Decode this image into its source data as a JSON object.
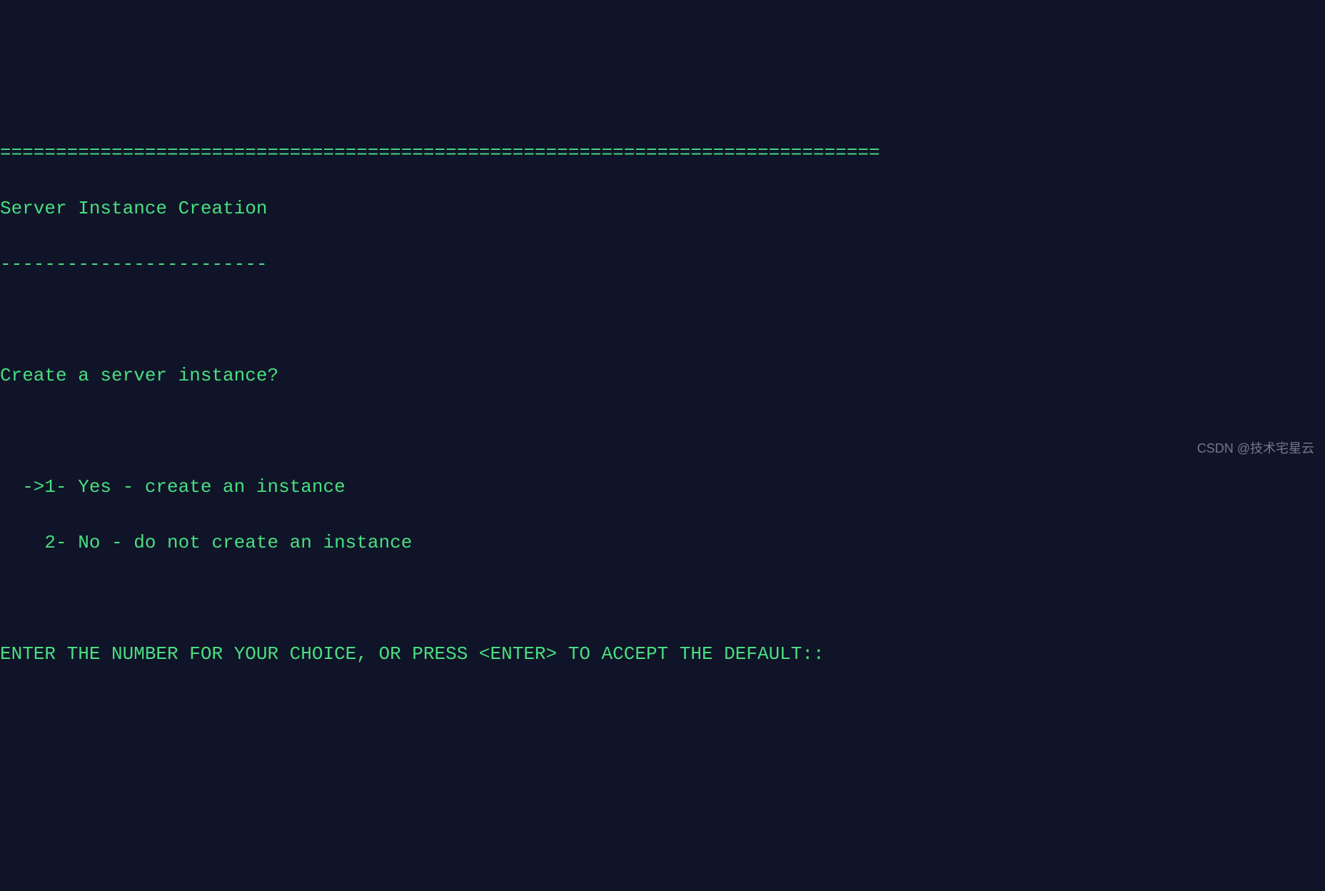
{
  "terminal": {
    "separator": "===============================================================================",
    "title": "Server Instance Creation",
    "underline": "------------------------",
    "question": "Create a server instance?",
    "option1_prefix": "  ->1- ",
    "option1_text": "Yes - create an instance",
    "option2_prefix": "    2- ",
    "option2_text": "No - do not create an instance",
    "prompt": "ENTER THE NUMBER FOR YOUR CHOICE, OR PRESS <ENTER> TO ACCEPT THE DEFAULT::"
  },
  "watermark": "CSDN @技术宅星云"
}
